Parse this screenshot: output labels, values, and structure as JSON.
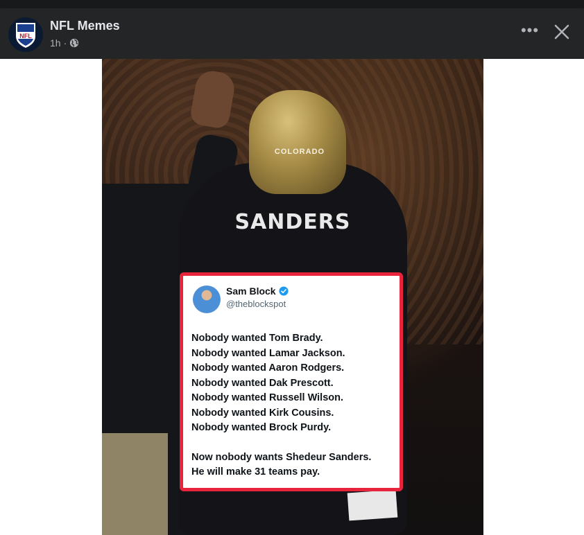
{
  "post": {
    "page_name": "NFL Memes",
    "time": "1h",
    "separator": "·",
    "privacy_icon": "globe-icon",
    "more_label": "•••",
    "close_icon": "close-icon",
    "avatar_logo_text": "NFL"
  },
  "image": {
    "helmet_text": "COLORADO",
    "jersey_name": "SANDERS",
    "tweet": {
      "name": "Sam Block",
      "verified_icon": "verified-badge-icon",
      "handle": "@theblockspot",
      "lines": [
        "Nobody wanted Tom Brady.",
        "Nobody wanted Lamar Jackson.",
        "Nobody wanted Aaron Rodgers.",
        "Nobody wanted Dak Prescott.",
        "Nobody wanted Russell Wilson.",
        "Nobody wanted Kirk Cousins.",
        "Nobody wanted Brock Purdy."
      ],
      "closing_lines": [
        "Now nobody wants Shedeur Sanders.",
        "He will make 31 teams pay."
      ],
      "border_color": "#e8243c"
    }
  },
  "colors": {
    "header_bg": "#242526",
    "title_text": "#e4e6eb",
    "meta_text": "#b0b3b8"
  }
}
